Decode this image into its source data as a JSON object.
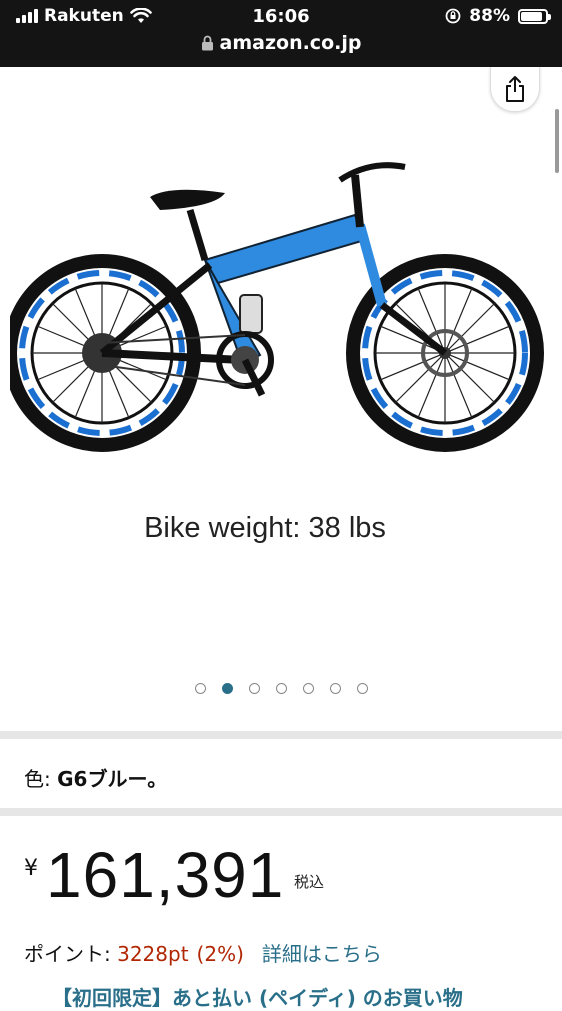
{
  "status_bar": {
    "carrier": "Rakuten",
    "time": "16:06",
    "battery_percent": "88%",
    "battery_level": 0.88
  },
  "url_bar": {
    "domain": "amazon.co.jp"
  },
  "gallery": {
    "image_caption": "Bike weight: 38 lbs",
    "dot_count": 7,
    "active_dot_index": 1
  },
  "product": {
    "color_label": "色: ",
    "color_value": "G6ブルー。",
    "currency_symbol": "¥",
    "price": "161,391",
    "tax_label": "税込",
    "points_label": "ポイント: ",
    "points_value": "3228pt",
    "points_percent": "(2%)",
    "details_link": "詳細はこちら",
    "promo_text": "【初回限定】あと払い (ペイディ) のお買い物"
  },
  "colors": {
    "accent_link": "#2a6f8a",
    "price_red": "#b12704",
    "topbar": "#141414"
  }
}
